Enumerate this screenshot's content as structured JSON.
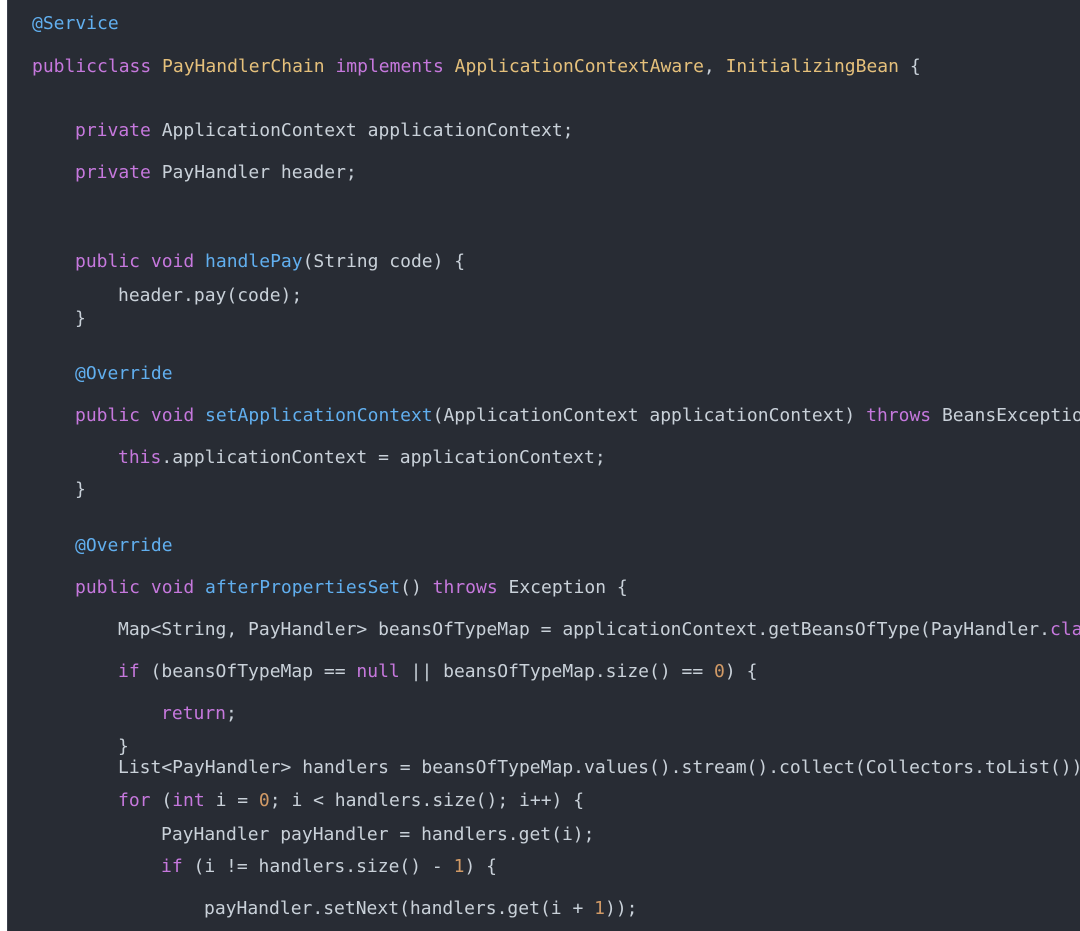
{
  "editor": {
    "theme": {
      "background": "#282c34",
      "plain": "#c9d1d9",
      "keyword": "#c678dd",
      "type": "#e5c07b",
      "function": "#61afef",
      "annotation": "#61afef",
      "number": "#d19a66"
    },
    "lines": [
      {
        "indent": 0,
        "tokens": [
          {
            "t": "@Service",
            "c": "annotation"
          }
        ]
      },
      {
        "indent": 0,
        "tokens": [
          {
            "t": "publicclass ",
            "c": "keyword"
          },
          {
            "t": "PayHandlerChain ",
            "c": "type"
          },
          {
            "t": "implements ",
            "c": "keyword"
          },
          {
            "t": "ApplicationContextAware",
            "c": "type"
          },
          {
            "t": ", ",
            "c": "plain"
          },
          {
            "t": "InitializingBean",
            "c": "type"
          },
          {
            "t": " {",
            "c": "plain"
          }
        ]
      },
      {
        "indent": 1,
        "tokens": [
          {
            "t": "private ",
            "c": "keyword"
          },
          {
            "t": "ApplicationContext applicationContext;",
            "c": "plain"
          }
        ]
      },
      {
        "indent": 1,
        "tokens": [
          {
            "t": "private ",
            "c": "keyword"
          },
          {
            "t": "PayHandler header;",
            "c": "plain"
          }
        ]
      },
      {
        "indent": 1,
        "tokens": [
          {
            "t": "public ",
            "c": "keyword"
          },
          {
            "t": "void ",
            "c": "keyword"
          },
          {
            "t": "handlePay",
            "c": "function"
          },
          {
            "t": "(String code) {",
            "c": "plain"
          }
        ]
      },
      {
        "indent": 2,
        "tokens": [
          {
            "t": "header.pay(code);",
            "c": "plain"
          }
        ]
      },
      {
        "indent": 1,
        "tokens": [
          {
            "t": "}",
            "c": "plain"
          }
        ]
      },
      {
        "indent": 1,
        "tokens": [
          {
            "t": "@Override",
            "c": "annotation"
          }
        ]
      },
      {
        "indent": 1,
        "tokens": [
          {
            "t": "public ",
            "c": "keyword"
          },
          {
            "t": "void ",
            "c": "keyword"
          },
          {
            "t": "setApplicationContext",
            "c": "function"
          },
          {
            "t": "(ApplicationContext applicationContext) ",
            "c": "plain"
          },
          {
            "t": "throws ",
            "c": "keyword"
          },
          {
            "t": "BeansExceptio",
            "c": "plain"
          }
        ]
      },
      {
        "indent": 2,
        "tokens": [
          {
            "t": "this",
            "c": "keyword"
          },
          {
            "t": ".applicationContext = applicationContext;",
            "c": "plain"
          }
        ]
      },
      {
        "indent": 1,
        "tokens": [
          {
            "t": "}",
            "c": "plain"
          }
        ]
      },
      {
        "indent": 1,
        "tokens": [
          {
            "t": "@Override",
            "c": "annotation"
          }
        ]
      },
      {
        "indent": 1,
        "tokens": [
          {
            "t": "public ",
            "c": "keyword"
          },
          {
            "t": "void ",
            "c": "keyword"
          },
          {
            "t": "afterPropertiesSet",
            "c": "function"
          },
          {
            "t": "() ",
            "c": "plain"
          },
          {
            "t": "throws ",
            "c": "keyword"
          },
          {
            "t": "Exception {",
            "c": "plain"
          }
        ]
      },
      {
        "indent": 2,
        "tokens": [
          {
            "t": "Map<String, PayHandler> beansOfTypeMap = applicationContext.getBeansOfType(PayHandler.",
            "c": "plain"
          },
          {
            "t": "cla",
            "c": "keyword"
          }
        ]
      },
      {
        "indent": 2,
        "tokens": [
          {
            "t": "if ",
            "c": "keyword"
          },
          {
            "t": "(beansOfTypeMap == ",
            "c": "plain"
          },
          {
            "t": "null ",
            "c": "keyword"
          },
          {
            "t": "|| beansOfTypeMap.size() == ",
            "c": "plain"
          },
          {
            "t": "0",
            "c": "number"
          },
          {
            "t": ") {",
            "c": "plain"
          }
        ]
      },
      {
        "indent": 3,
        "tokens": [
          {
            "t": "return",
            "c": "keyword"
          },
          {
            "t": ";",
            "c": "plain"
          }
        ]
      },
      {
        "indent": 2,
        "tokens": [
          {
            "t": "}",
            "c": "plain"
          }
        ]
      },
      {
        "indent": 2,
        "tokens": [
          {
            "t": "List<PayHandler> handlers = beansOfTypeMap.values().stream().collect(Collectors.toList())",
            "c": "plain"
          }
        ]
      },
      {
        "indent": 2,
        "tokens": [
          {
            "t": "for ",
            "c": "keyword"
          },
          {
            "t": "(",
            "c": "plain"
          },
          {
            "t": "int ",
            "c": "keyword"
          },
          {
            "t": "i = ",
            "c": "plain"
          },
          {
            "t": "0",
            "c": "number"
          },
          {
            "t": "; i < handlers.size(); i++) {",
            "c": "plain"
          }
        ]
      },
      {
        "indent": 3,
        "tokens": [
          {
            "t": "PayHandler payHandler = handlers.get(i);",
            "c": "plain"
          }
        ]
      },
      {
        "indent": 3,
        "tokens": [
          {
            "t": "if ",
            "c": "keyword"
          },
          {
            "t": "(i != handlers.size() - ",
            "c": "plain"
          },
          {
            "t": "1",
            "c": "number"
          },
          {
            "t": ") {",
            "c": "plain"
          }
        ]
      },
      {
        "indent": 4,
        "tokens": [
          {
            "t": "payHandler.setNext(handlers.get(i + ",
            "c": "plain"
          },
          {
            "t": "1",
            "c": "number"
          },
          {
            "t": "));",
            "c": "plain"
          }
        ]
      }
    ]
  }
}
